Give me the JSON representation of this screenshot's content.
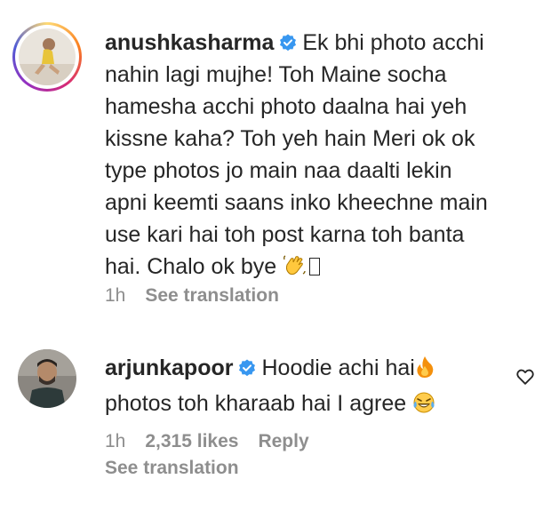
{
  "comments": [
    {
      "username": "anushkasharma",
      "verified": true,
      "lines": [
        "Ek bhi photo acchi",
        "nahin lagi mujhe! Toh Maine socha",
        "hamesha acchi photo daalna hai yeh",
        "kissne kaha? Toh yeh hain Meri ok ok",
        "type photos jo main naa daalti lekin",
        "apni keemti saans inko kheechne main",
        "use kari hai toh post karna toh banta",
        "hai. Chalo ok bye"
      ],
      "time": "1h",
      "see_translation": "See translation",
      "emoji_end": "waving-hand-emoji"
    },
    {
      "username": "arjunkapoor",
      "verified": true,
      "lines": [
        "Hoodie achi hai",
        "photos toh kharaab hai I agree"
      ],
      "time": "1h",
      "likes": "2,315 likes",
      "reply": "Reply",
      "see_translation": "See translation"
    }
  ],
  "colors": {
    "text": "#262626",
    "muted": "#8e8e8e",
    "verified_blue": "#3897f0"
  }
}
